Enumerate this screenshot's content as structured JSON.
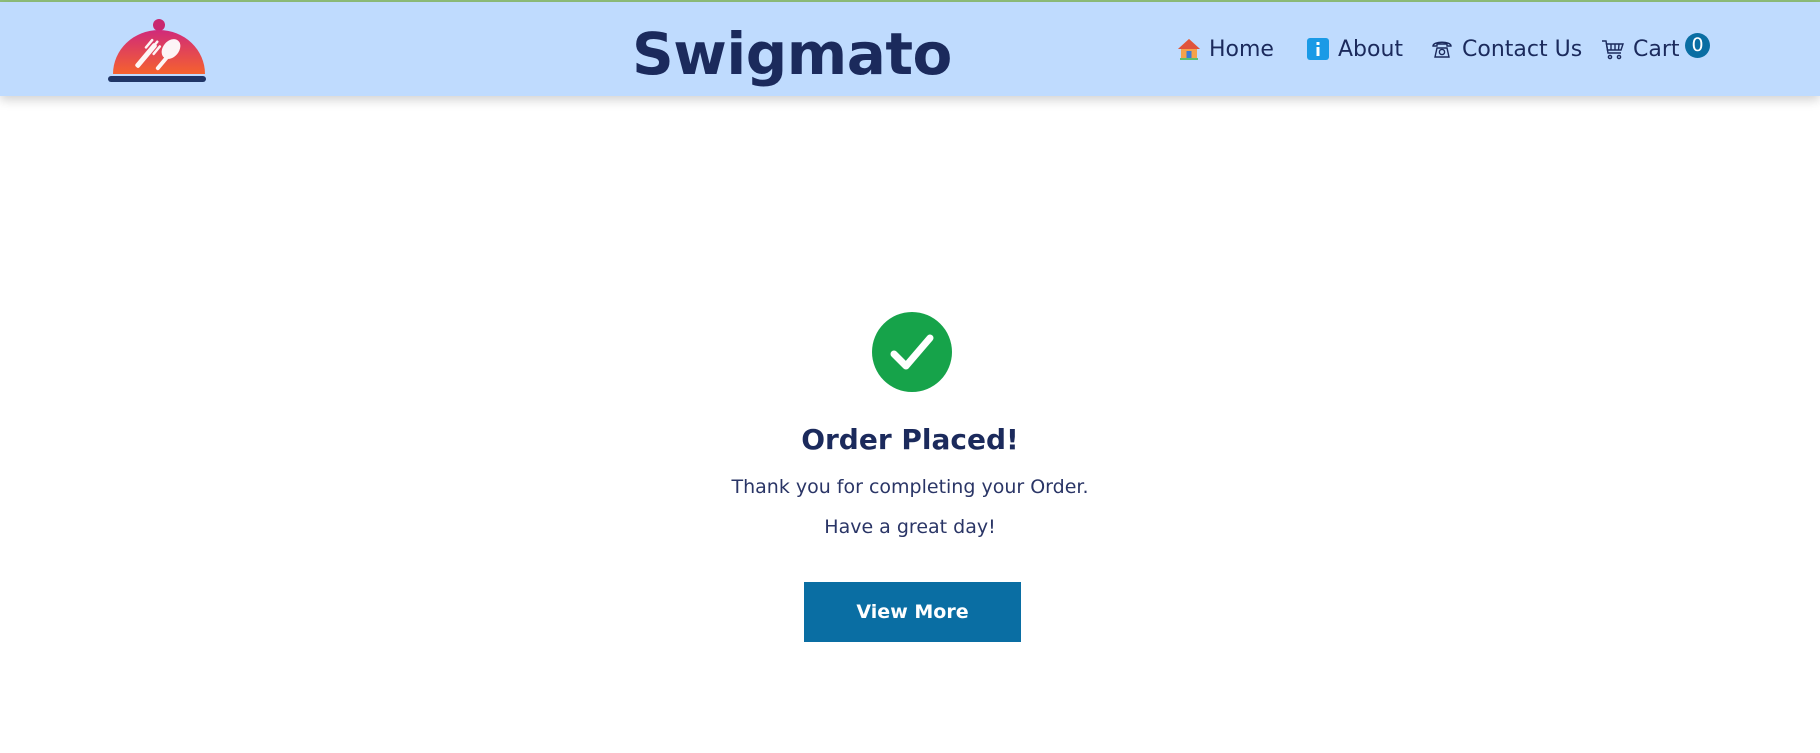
{
  "header": {
    "brand": "Swigmato",
    "nav": {
      "home": "Home",
      "about": "About",
      "contact": "Contact Us",
      "cart": "Cart"
    },
    "cart_count": "0"
  },
  "main": {
    "title": "Order Placed!",
    "message_1": "Thank you for completing your Order.",
    "message_2": "Have a great day!",
    "button_label": "View More"
  },
  "icons": {
    "logo": "food-cloche-logo",
    "home": "house-icon",
    "about": "info-icon",
    "contact": "telephone-icon",
    "cart": "shopping-cart-icon",
    "success": "check-circle-icon"
  },
  "colors": {
    "header_bg": "#bfdbfe",
    "text_dark": "#1b2a5c",
    "accent_blue": "#0a6ea3",
    "success_green": "#16a34a"
  }
}
